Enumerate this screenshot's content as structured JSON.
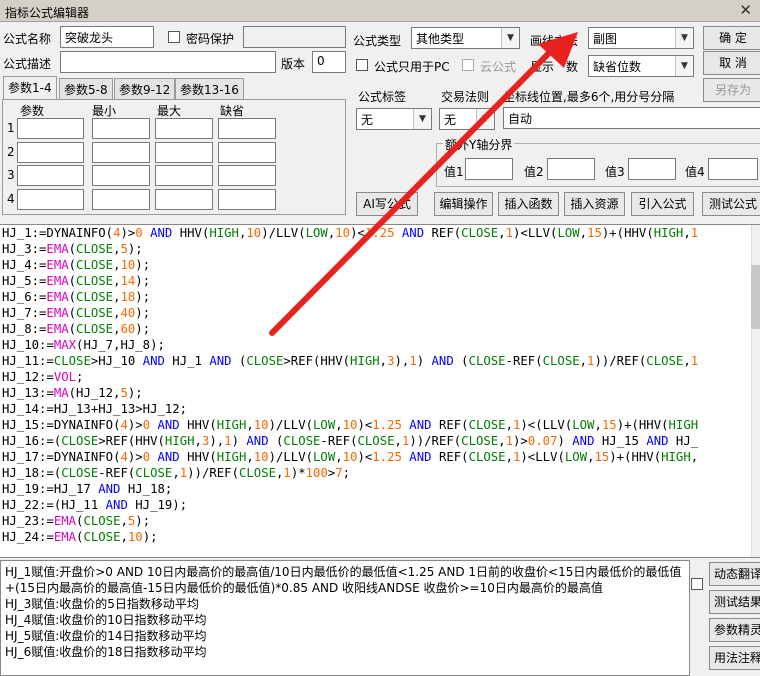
{
  "window": {
    "title": "指标公式编辑器",
    "close": "✕"
  },
  "form": {
    "name_label": "公式名称",
    "name_value": "突破龙头",
    "password_label": "密码保护",
    "desc_label": "公式描述",
    "version_label": "版本",
    "version_value": "0",
    "type_label": "公式类型",
    "type_value": "其他类型",
    "draw_label": "画线方法",
    "draw_value": "副图",
    "pc_only_label": "公式只用于PC",
    "cloud_label": "云公式",
    "display_label": "显示",
    "decimal_suffix": "数",
    "decimal_value": "缺省位数",
    "ok": "确 定",
    "cancel": "取 消",
    "save_as": "另存为",
    "tag_label": "公式标签",
    "tag_value": "无",
    "trade_label": "交易法则",
    "trade_value": "无",
    "coord_label": "坐标线位置,最多6个,用分号分隔",
    "coord_value": "自动",
    "yaxis_label": "额外Y轴分界",
    "v1": "值1",
    "v2": "值2",
    "v3": "值3",
    "v4": "值4"
  },
  "tabs": [
    "参数1-4",
    "参数5-8",
    "参数9-12",
    "参数13-16"
  ],
  "params": {
    "headers": [
      "参数",
      "最小",
      "最大",
      "缺省"
    ],
    "rows": [
      "1",
      "2",
      "3",
      "4"
    ]
  },
  "toolbar": {
    "ai": "AI写公式",
    "edit": "编辑操作",
    "insert_fn": "插入函数",
    "insert_res": "插入资源",
    "import": "引入公式",
    "test": "测试公式"
  },
  "code": [
    [
      [
        "HJ_1:=",
        0
      ],
      [
        "DYNAINFO",
        0
      ],
      [
        "(",
        0
      ],
      [
        "4",
        2
      ],
      [
        ")>",
        0
      ],
      [
        "0",
        2
      ],
      [
        " AND ",
        3
      ],
      [
        "HHV",
        0
      ],
      [
        "(",
        0
      ],
      [
        "HIGH",
        1
      ],
      [
        ",",
        0
      ],
      [
        "10",
        2
      ],
      [
        ")/",
        0
      ],
      [
        "LLV",
        0
      ],
      [
        "(",
        0
      ],
      [
        "LOW",
        1
      ],
      [
        ",",
        0
      ],
      [
        "10",
        2
      ],
      [
        ")<",
        0
      ],
      [
        "1.25",
        2
      ],
      [
        " AND ",
        3
      ],
      [
        "REF",
        0
      ],
      [
        "(",
        0
      ],
      [
        "CLOSE",
        1
      ],
      [
        ",",
        0
      ],
      [
        "1",
        2
      ],
      [
        ")<",
        0
      ],
      [
        "LLV",
        0
      ],
      [
        "(",
        0
      ],
      [
        "LOW",
        1
      ],
      [
        ",",
        0
      ],
      [
        "15",
        2
      ],
      [
        ")+(",
        0
      ],
      [
        "HHV",
        0
      ],
      [
        "(",
        0
      ],
      [
        "HIGH",
        1
      ],
      [
        ",",
        0
      ],
      [
        "1",
        2
      ]
    ],
    [
      [
        "HJ_3:=",
        0
      ],
      [
        "EMA",
        4
      ],
      [
        "(",
        0
      ],
      [
        "CLOSE",
        1
      ],
      [
        ",",
        0
      ],
      [
        "5",
        2
      ],
      [
        ");",
        0
      ]
    ],
    [
      [
        "HJ_4:=",
        0
      ],
      [
        "EMA",
        4
      ],
      [
        "(",
        0
      ],
      [
        "CLOSE",
        1
      ],
      [
        ",",
        0
      ],
      [
        "10",
        2
      ],
      [
        ");",
        0
      ]
    ],
    [
      [
        "HJ_5:=",
        0
      ],
      [
        "EMA",
        4
      ],
      [
        "(",
        0
      ],
      [
        "CLOSE",
        1
      ],
      [
        ",",
        0
      ],
      [
        "14",
        2
      ],
      [
        ");",
        0
      ]
    ],
    [
      [
        "HJ_6:=",
        0
      ],
      [
        "EMA",
        4
      ],
      [
        "(",
        0
      ],
      [
        "CLOSE",
        1
      ],
      [
        ",",
        0
      ],
      [
        "18",
        2
      ],
      [
        ");",
        0
      ]
    ],
    [
      [
        "HJ_7:=",
        0
      ],
      [
        "EMA",
        4
      ],
      [
        "(",
        0
      ],
      [
        "CLOSE",
        1
      ],
      [
        ",",
        0
      ],
      [
        "40",
        2
      ],
      [
        ");",
        0
      ]
    ],
    [
      [
        "HJ_8:=",
        0
      ],
      [
        "EMA",
        4
      ],
      [
        "(",
        0
      ],
      [
        "CLOSE",
        1
      ],
      [
        ",",
        0
      ],
      [
        "60",
        2
      ],
      [
        ");",
        0
      ]
    ],
    [
      [
        "HJ_10:=",
        0
      ],
      [
        "MAX",
        4
      ],
      [
        "(HJ_7,HJ_8);",
        0
      ]
    ],
    [
      [
        "HJ_11:=",
        0
      ],
      [
        "CLOSE",
        1
      ],
      [
        ">HJ_10 ",
        0
      ],
      [
        "AND",
        3
      ],
      [
        " HJ_1 ",
        0
      ],
      [
        "AND",
        3
      ],
      [
        " (",
        0
      ],
      [
        "CLOSE",
        1
      ],
      [
        ">",
        0
      ],
      [
        "REF",
        0
      ],
      [
        "(",
        0
      ],
      [
        "HHV",
        0
      ],
      [
        "(",
        0
      ],
      [
        "HIGH",
        1
      ],
      [
        ",",
        0
      ],
      [
        "3",
        2
      ],
      [
        "),",
        0
      ],
      [
        "1",
        2
      ],
      [
        ") ",
        0
      ],
      [
        "AND",
        3
      ],
      [
        " (",
        0
      ],
      [
        "CLOSE",
        1
      ],
      [
        "-",
        0
      ],
      [
        "REF",
        0
      ],
      [
        "(",
        0
      ],
      [
        "CLOSE",
        1
      ],
      [
        ",",
        0
      ],
      [
        "1",
        2
      ],
      [
        "))/",
        0
      ],
      [
        "REF",
        0
      ],
      [
        "(",
        0
      ],
      [
        "CLOSE",
        1
      ],
      [
        ",",
        0
      ],
      [
        "1",
        2
      ]
    ],
    [
      [
        "HJ_12:=",
        0
      ],
      [
        "VOL",
        4
      ],
      [
        ";",
        0
      ]
    ],
    [
      [
        "HJ_13:=",
        0
      ],
      [
        "MA",
        4
      ],
      [
        "(HJ_12,",
        0
      ],
      [
        "5",
        2
      ],
      [
        ");",
        0
      ]
    ],
    [
      [
        "HJ_14:=HJ_13+HJ_13>HJ_12;",
        0
      ]
    ],
    [
      [
        "HJ_15:=",
        0
      ],
      [
        "DYNAINFO",
        0
      ],
      [
        "(",
        0
      ],
      [
        "4",
        2
      ],
      [
        ")>",
        0
      ],
      [
        "0",
        2
      ],
      [
        " AND ",
        3
      ],
      [
        "HHV",
        0
      ],
      [
        "(",
        0
      ],
      [
        "HIGH",
        1
      ],
      [
        ",",
        0
      ],
      [
        "10",
        2
      ],
      [
        ")/",
        0
      ],
      [
        "LLV",
        0
      ],
      [
        "(",
        0
      ],
      [
        "LOW",
        1
      ],
      [
        ",",
        0
      ],
      [
        "10",
        2
      ],
      [
        ")<",
        0
      ],
      [
        "1.25",
        2
      ],
      [
        " AND ",
        3
      ],
      [
        "REF",
        0
      ],
      [
        "(",
        0
      ],
      [
        "CLOSE",
        1
      ],
      [
        ",",
        0
      ],
      [
        "1",
        2
      ],
      [
        ")<(",
        0
      ],
      [
        "LLV",
        0
      ],
      [
        "(",
        0
      ],
      [
        "LOW",
        1
      ],
      [
        ",",
        0
      ],
      [
        "15",
        2
      ],
      [
        ")+(",
        0
      ],
      [
        "HHV",
        0
      ],
      [
        "(",
        0
      ],
      [
        "HIGH",
        1
      ]
    ],
    [
      [
        "HJ_16:=(",
        0
      ],
      [
        "CLOSE",
        1
      ],
      [
        ">",
        0
      ],
      [
        "REF",
        0
      ],
      [
        "(",
        0
      ],
      [
        "HHV",
        0
      ],
      [
        "(",
        0
      ],
      [
        "HIGH",
        1
      ],
      [
        ",",
        0
      ],
      [
        "3",
        2
      ],
      [
        "),",
        0
      ],
      [
        "1",
        2
      ],
      [
        ") ",
        0
      ],
      [
        "AND",
        3
      ],
      [
        " (",
        0
      ],
      [
        "CLOSE",
        1
      ],
      [
        "-",
        0
      ],
      [
        "REF",
        0
      ],
      [
        "(",
        0
      ],
      [
        "CLOSE",
        1
      ],
      [
        ",",
        0
      ],
      [
        "1",
        2
      ],
      [
        "))/",
        0
      ],
      [
        "REF",
        0
      ],
      [
        "(",
        0
      ],
      [
        "CLOSE",
        1
      ],
      [
        ",",
        0
      ],
      [
        "1",
        2
      ],
      [
        ")>",
        0
      ],
      [
        "0.07",
        2
      ],
      [
        ") ",
        0
      ],
      [
        "AND",
        3
      ],
      [
        " HJ_15 ",
        0
      ],
      [
        "AND",
        3
      ],
      [
        " HJ_",
        0
      ]
    ],
    [
      [
        "HJ_17:=",
        0
      ],
      [
        "DYNAINFO",
        0
      ],
      [
        "(",
        0
      ],
      [
        "4",
        2
      ],
      [
        ")>",
        0
      ],
      [
        "0",
        2
      ],
      [
        " AND ",
        3
      ],
      [
        "HHV",
        0
      ],
      [
        "(",
        0
      ],
      [
        "HIGH",
        1
      ],
      [
        ",",
        0
      ],
      [
        "10",
        2
      ],
      [
        ")/",
        0
      ],
      [
        "LLV",
        0
      ],
      [
        "(",
        0
      ],
      [
        "LOW",
        1
      ],
      [
        ",",
        0
      ],
      [
        "10",
        2
      ],
      [
        ")<",
        0
      ],
      [
        "1.25",
        2
      ],
      [
        " AND ",
        3
      ],
      [
        "REF",
        0
      ],
      [
        "(",
        0
      ],
      [
        "CLOSE",
        1
      ],
      [
        ",",
        0
      ],
      [
        "1",
        2
      ],
      [
        ")<",
        0
      ],
      [
        "LLV",
        0
      ],
      [
        "(",
        0
      ],
      [
        "LOW",
        1
      ],
      [
        ",",
        0
      ],
      [
        "15",
        2
      ],
      [
        ")+(",
        0
      ],
      [
        "HHV",
        0
      ],
      [
        "(",
        0
      ],
      [
        "HIGH",
        1
      ],
      [
        ",",
        0
      ]
    ],
    [
      [
        "HJ_18:=(",
        0
      ],
      [
        "CLOSE",
        1
      ],
      [
        "-",
        0
      ],
      [
        "REF",
        0
      ],
      [
        "(",
        0
      ],
      [
        "CLOSE",
        1
      ],
      [
        ",",
        0
      ],
      [
        "1",
        2
      ],
      [
        "))/",
        0
      ],
      [
        "REF",
        0
      ],
      [
        "(",
        0
      ],
      [
        "CLOSE",
        1
      ],
      [
        ",",
        0
      ],
      [
        "1",
        2
      ],
      [
        ")*",
        0
      ],
      [
        "100",
        2
      ],
      [
        ">",
        0
      ],
      [
        "7",
        2
      ],
      [
        ";",
        0
      ]
    ],
    [
      [
        "HJ_19:=HJ_17 ",
        0
      ],
      [
        "AND",
        3
      ],
      [
        " HJ_18;",
        0
      ]
    ],
    [
      [
        "HJ_22:=(HJ_11 ",
        0
      ],
      [
        "AND",
        3
      ],
      [
        " HJ_19);",
        0
      ]
    ],
    [
      [
        "HJ_23:=",
        0
      ],
      [
        "EMA",
        4
      ],
      [
        "(",
        0
      ],
      [
        "CLOSE",
        1
      ],
      [
        ",",
        0
      ],
      [
        "5",
        2
      ],
      [
        ");",
        0
      ]
    ],
    [
      [
        "HJ_24:=",
        0
      ],
      [
        "EMA",
        4
      ],
      [
        "(",
        0
      ],
      [
        "CLOSE",
        1
      ],
      [
        ",",
        0
      ],
      [
        "10",
        2
      ],
      [
        ");",
        0
      ]
    ]
  ],
  "code_colors": [
    "#000000",
    "#008000",
    "#ff6600",
    "#0000ff",
    "#e000c0"
  ],
  "descriptions": [
    "HJ_1赋值:开盘价>0 AND 10日内最高价的最高值/10日内最低价的最低值<1.25 AND 1日前的收盘价<15日内最低价的最低值",
    "+(15日内最高价的最高值-15日内最低价的最低值)*0.85 AND 收阳线ANDSE 收盘价>=10日内最高价的最高值",
    "HJ_3赋值:收盘价的5日指数移动平均",
    "HJ_4赋值:收盘价的10日指数移动平均",
    "HJ_5赋值:收盘价的14日指数移动平均",
    "HJ_6赋值:收盘价的18日指数移动平均"
  ],
  "side_buttons": [
    "动态翻译",
    "测试结果",
    "参数精灵",
    "用法注释"
  ],
  "colors": {
    "arrow": "#e8231f",
    "keyword": "#0000ff",
    "function": "#e000c0",
    "field": "#008000",
    "number": "#ff6600"
  }
}
